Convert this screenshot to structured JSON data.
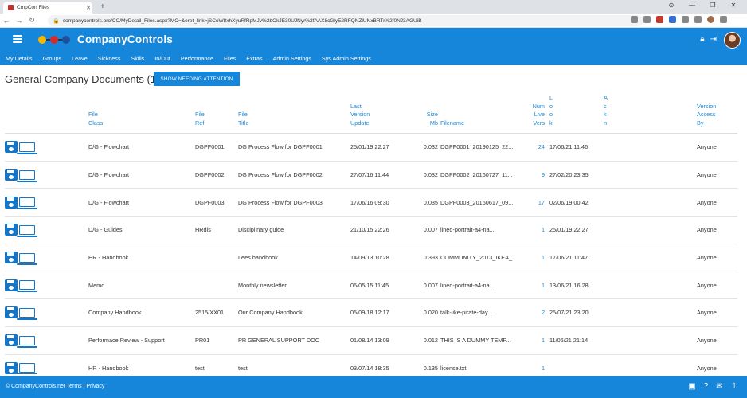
{
  "browser": {
    "tab_title": "CmpCon Files",
    "tab_close": "✕",
    "new_tab": "+",
    "url": "companycontrols.pro/CC/MyDetail_Files.aspx?MC=&eret_link=jSCoW8xhXyuRfRpMJv%2bOkJE30UJNyr%2fAAX8cGlyE2RFQNZlUNxBRTr%2f0NJ3AGUiB",
    "window_controls": [
      "⊙",
      "—",
      "❐",
      "✕"
    ]
  },
  "app": {
    "brand": "CompanyControls",
    "logo_colors": [
      "#f5b800",
      "#d22c2c",
      "#1d4f9a"
    ]
  },
  "menu": [
    "My Details",
    "Groups",
    "Leave",
    "Sickness",
    "Skills",
    "In/Out",
    "Performance",
    "Files",
    "Extras",
    "Admin Settings",
    "Sys Admin Settings"
  ],
  "page": {
    "title": "General Company Documents (10)",
    "attention_button": "SHOW NEEDING ATTENTION"
  },
  "table": {
    "headers": {
      "file_class": [
        "File",
        "Class"
      ],
      "file_ref": [
        "File",
        "Ref"
      ],
      "file_title": [
        "File",
        "Title"
      ],
      "last_version": [
        "Last",
        "Version",
        "Update"
      ],
      "size": [
        "Size",
        "Mb"
      ],
      "filename": [
        "Filename"
      ],
      "num_live": [
        "Num",
        "Live",
        "Vers"
      ],
      "look": [
        "L",
        "o",
        "o",
        "k"
      ],
      "ack": [
        "A",
        "c",
        "k",
        "n"
      ],
      "version_access": [
        "Version",
        "Access",
        "By"
      ]
    },
    "rows": [
      {
        "file_class": "D/G - Flowchart",
        "file_ref": "DGPF0001",
        "title": "DG Process Flow for DGPF0001",
        "updated": "25/01/19 22:27",
        "size": "0.032",
        "filename": "DGPF0001_20190125_22...",
        "live": "24",
        "look": "17/06/21 11:46",
        "access": "Anyone"
      },
      {
        "file_class": "D/G - Flowchart",
        "file_ref": "DGPF0002",
        "title": "DG Process Flow for DGPF0002",
        "updated": "27/07/16 11:44",
        "size": "0.032",
        "filename": "DGPF0002_20160727_11...",
        "live": "9",
        "look": "27/02/20 23:35",
        "access": "Anyone"
      },
      {
        "file_class": "D/G - Flowchart",
        "file_ref": "DGPF0003",
        "title": "DG Process Flow for DGPF0003",
        "updated": "17/06/16 09:30",
        "size": "0.035",
        "filename": "DGPF0003_20160617_09...",
        "live": "17",
        "look": "02/06/19 00:42",
        "access": "Anyone"
      },
      {
        "file_class": "D/G - Guides",
        "file_ref": "HRdis",
        "title": "Disciplinary guide",
        "updated": "21/10/15 22:26",
        "size": "0.007",
        "filename": "lined-portrait-a4-na...",
        "live": "1",
        "look": "25/01/19 22:27",
        "access": "Anyone"
      },
      {
        "file_class": "HR - Handbook",
        "file_ref": "",
        "title": "Lees handbook",
        "updated": "14/09/13 10:28",
        "size": "0.393",
        "filename": "COMMUNITY_2013_IKEA_...",
        "live": "1",
        "look": "17/06/21 11:47",
        "access": "Anyone"
      },
      {
        "file_class": "Memo",
        "file_ref": "",
        "title": "Monthly newsletter",
        "updated": "06/05/15 11:45",
        "size": "0.007",
        "filename": "lined-portrait-a4-na...",
        "live": "1",
        "look": "13/06/21 16:28",
        "access": "Anyone"
      },
      {
        "file_class": "Company Handbook",
        "file_ref": "2515/XX01",
        "title": "Our Company Handbook",
        "updated": "05/09/18 12:17",
        "size": "0.020",
        "filename": "talk-like-pirate-day...",
        "live": "2",
        "look": "25/07/21 23:20",
        "access": "Anyone"
      },
      {
        "file_class": "Performace Review - Support",
        "file_ref": "PR01",
        "title": "PR GENERAL SUPPORT DOC",
        "updated": "01/08/14 13:09",
        "size": "0.012",
        "filename": "THIS IS A DUMMY TEMP...",
        "live": "1",
        "look": "11/06/21 21:14",
        "access": "Anyone"
      },
      {
        "file_class": "HR - Handbook",
        "file_ref": "test",
        "title": "test",
        "updated": "03/07/14 18:35",
        "size": "0.135",
        "filename": "license.txt",
        "live": "1",
        "look": "",
        "access": "Anyone"
      }
    ]
  },
  "footer": {
    "text": "© CompanyControls.net Terms | Privacy"
  }
}
